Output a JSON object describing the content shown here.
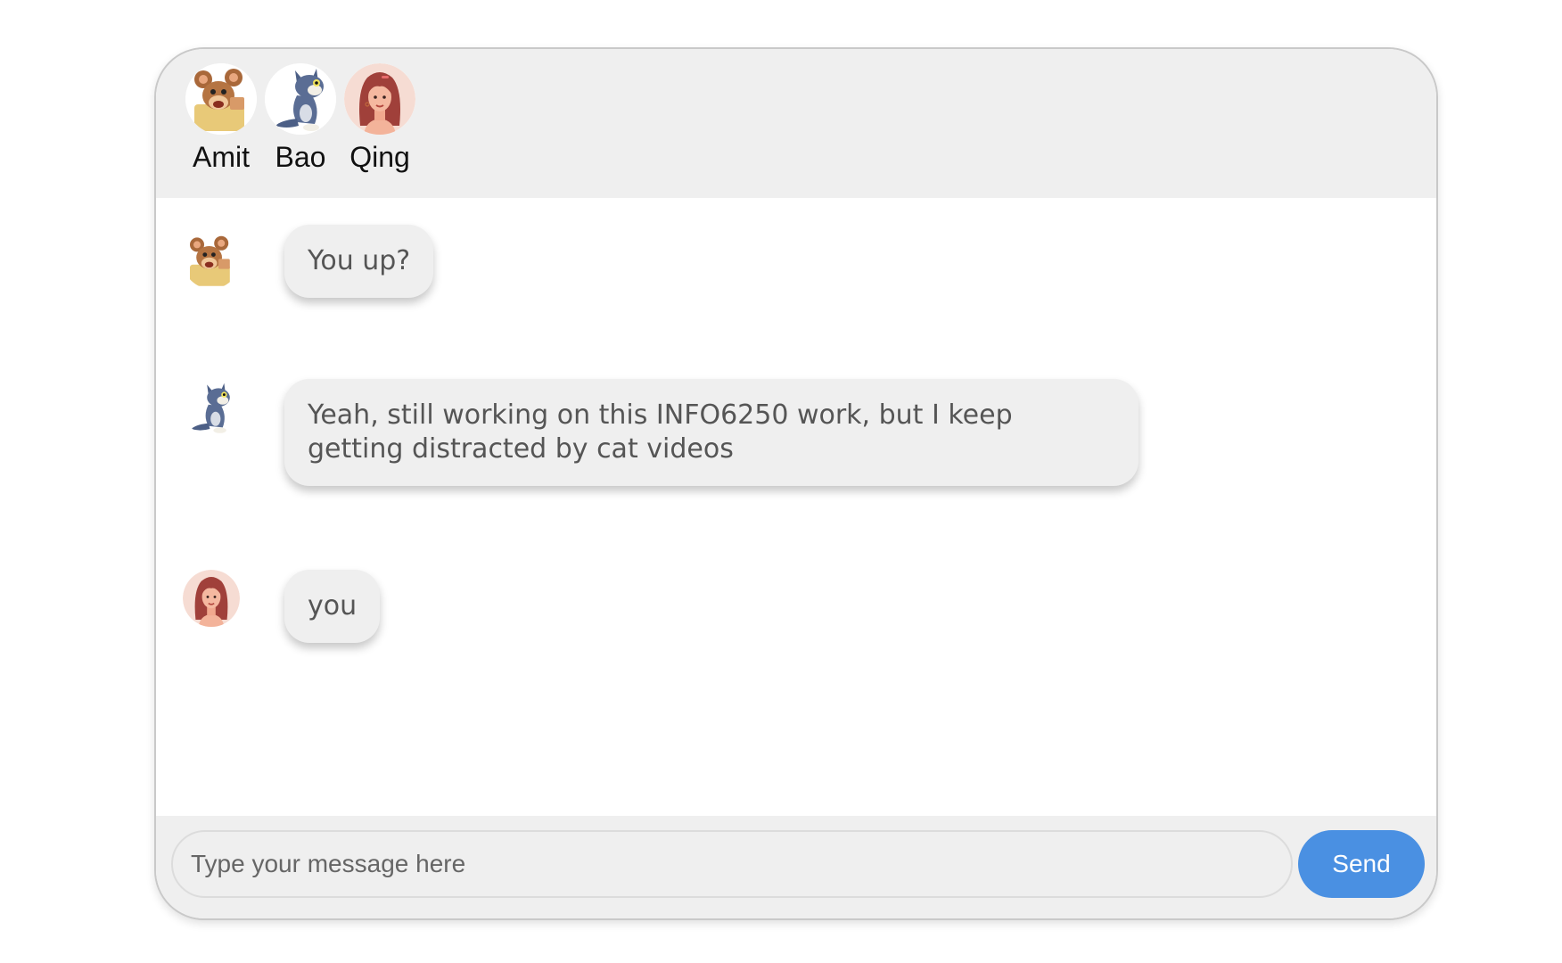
{
  "participants": [
    {
      "name": "Amit",
      "avatar": "mouse-avatar-icon"
    },
    {
      "name": "Bao",
      "avatar": "cat-avatar-icon"
    },
    {
      "name": "Qing",
      "avatar": "woman-avatar-icon"
    }
  ],
  "messages": [
    {
      "sender": "Amit",
      "text": "You up?"
    },
    {
      "sender": "Bao",
      "text": "Yeah, still working on this INFO6250 work, but I keep getting distracted by cat videos"
    },
    {
      "sender": "Qing",
      "text": "you"
    }
  ],
  "composer": {
    "placeholder": "Type your message here",
    "send_label": "Send"
  },
  "colors": {
    "send_button": "#4a90e2",
    "panel_background": "#efefef",
    "bubble_background": "#efefef",
    "bubble_text": "#555555"
  }
}
